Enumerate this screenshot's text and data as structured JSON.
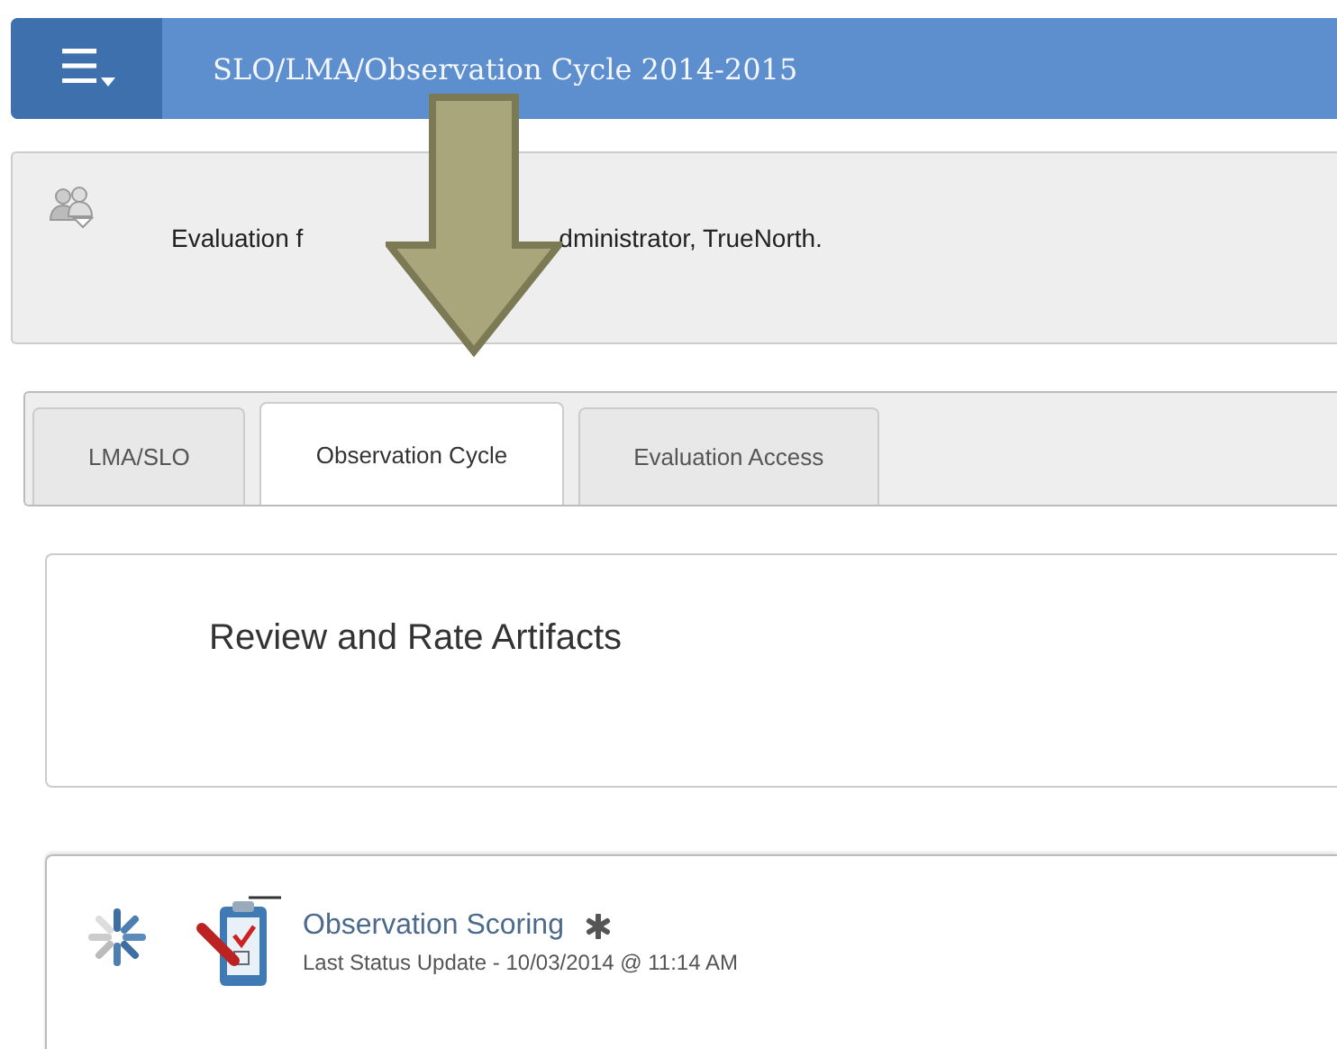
{
  "header": {
    "menu_icon": "☰",
    "title": "SLO/LMA/Observation Cycle 2014-2015"
  },
  "info": {
    "text_parts": [
      "Evaluation f",
      "dministrator, TrueNorth."
    ]
  },
  "tabs": [
    {
      "label": "LMA/SLO",
      "selected": false
    },
    {
      "label": "Observation Cycle",
      "selected": true
    },
    {
      "label": "Evaluation Access",
      "selected": false
    }
  ],
  "section": {
    "heading": "Review and Rate Artifacts"
  },
  "items": [
    {
      "title": "Observation Scoring",
      "status": "Last Status Update - 10/03/2014 @ 11:14 AM"
    }
  ]
}
